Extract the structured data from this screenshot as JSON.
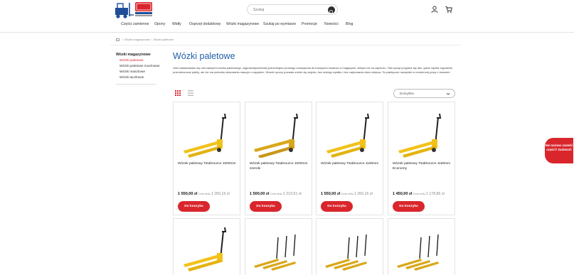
{
  "header": {
    "search_placeholder": "Szukaj"
  },
  "nav": {
    "items": [
      "Części zamienne",
      "Opony",
      "Widły",
      "Osprzęt dodatkowy",
      "Wózki magazynowe",
      "Szukaj po wymiarze",
      "Promocje",
      "Nowości",
      "Blog"
    ]
  },
  "breadcrumb": {
    "items": [
      "Wózki magazynowe",
      "Wózki paletowe"
    ]
  },
  "sidebar": {
    "title": "Wózki magazynowe",
    "items": [
      {
        "label": "Wózki paletowe",
        "active": true
      },
      {
        "label": "Wózki paletowe inox/nowe"
      },
      {
        "label": "Wózki masztowe"
      },
      {
        "label": "Wózki taczkowe"
      }
    ]
  },
  "main": {
    "title": "Wózki paletowe",
    "description": "Jeśli zastanawiasz się nad zakupem wózka paletowego, najprawdopodobniej potrzebujesz prostego rozwiązania do transportu towarów w magazynie, sklepie lub na zapleczu. Taki sprzęt przyjdzie się tam, gdzie ciężkie regularnie przemieszczać palety, ale nie ma potrzeby stosowania maszyn z napędem. Wózek ręczny pozwala znieść się szybko, bez dużego wysiłku i bez zajmowania dużo miejsca. Ta praktyczne narzędzie w codziennej pracy z towarem.",
    "sort_label": "Domyślne"
  },
  "products": [
    {
      "name": "Wózek paletowy TotalSource 1000mm",
      "price": "1 550,00 zł",
      "old_label": "Cena netto",
      "old_price": "1 260,16 zł",
      "button": "Do koszyka"
    },
    {
      "name": "Wózek paletowy TotalSource 1000mm szeroki",
      "price": "1 500,00 zł",
      "old_label": "Cena netto",
      "old_price": "1 219,51 zł",
      "button": "Do koszyka"
    },
    {
      "name": "Wózek paletowy TotalSource 1150mm",
      "price": "1 550,00 zł",
      "old_label": "Cena netto",
      "old_price": "1 260,16 zł",
      "button": "Do koszyka"
    },
    {
      "name": "Wózek paletowy TotalSource 1150mm Economy",
      "price": "1 450,00 zł",
      "old_label": "Cena netto",
      "old_price": "1 178,86 zł",
      "button": "Do koszyka"
    }
  ],
  "help": {
    "text": "Nie możesz znaleźć części? Zadzwoń!"
  },
  "colors": {
    "accent": "#d9262c",
    "title_blue": "#1f5fa8",
    "truck_yellow": "#f2c21b"
  }
}
